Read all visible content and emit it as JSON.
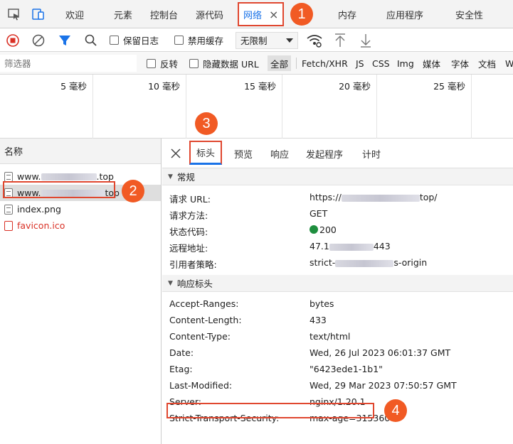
{
  "tabbar": {
    "tabs": [
      "欢迎",
      "元素",
      "控制台",
      "源代码",
      "网络",
      "内存",
      "应用程序",
      "安全性"
    ],
    "active_tab": "网络",
    "close_glyph": "×"
  },
  "toolbar": {
    "preserve_log": "保留日志",
    "disable_cache": "禁用缓存",
    "throttle": "无限制"
  },
  "filterbar": {
    "placeholder": "筛选器",
    "invert": "反转",
    "hide_data_urls": "隐藏数据 URL",
    "types": [
      "全部",
      "Fetch/XHR",
      "JS",
      "CSS",
      "Img",
      "媒体",
      "字体",
      "文档",
      "W"
    ],
    "selected_type": "全部"
  },
  "timeline": {
    "ticks": [
      "5 毫秒",
      "10 毫秒",
      "15 毫秒",
      "20 毫秒",
      "25 毫秒"
    ]
  },
  "requests": {
    "header": "名称",
    "items": [
      {
        "prefix": "www.",
        "suffix": ".top"
      },
      {
        "prefix": "www.",
        "suffix": "top"
      },
      {
        "name": "index.png"
      },
      {
        "name": "favicon.ico"
      }
    ]
  },
  "details": {
    "tabs": [
      "标头",
      "预览",
      "响应",
      "发起程序",
      "计时"
    ],
    "active_tab": "标头",
    "general": {
      "title": "常规",
      "rows": [
        {
          "k": "请求 URL:",
          "v_prefix": "https://",
          "v_suffix": "top/"
        },
        {
          "k": "请求方法:",
          "v": "GET"
        },
        {
          "k": "状态代码:",
          "v": "200"
        },
        {
          "k": "远程地址:",
          "v_prefix": "47.1",
          "v_suffix": "443"
        },
        {
          "k": "引用者策略:",
          "v_prefix": "strict-",
          "v_suffix": "s-origin"
        }
      ]
    },
    "response_headers": {
      "title": "响应标头",
      "rows": [
        {
          "k": "Accept-Ranges:",
          "v": "bytes"
        },
        {
          "k": "Content-Length:",
          "v": "433"
        },
        {
          "k": "Content-Type:",
          "v": "text/html"
        },
        {
          "k": "Date:",
          "v": "Wed, 26 Jul 2023 06:01:37 GMT"
        },
        {
          "k": "Etag:",
          "v": "\"6423ede1-1b1\""
        },
        {
          "k": "Last-Modified:",
          "v": "Wed, 29 Mar 2023 07:50:57 GMT"
        },
        {
          "k": "Server:",
          "v": "nginx/1.20.1"
        },
        {
          "k": "Strict-Transport-Security:",
          "v": "max-age=31536000"
        }
      ]
    }
  },
  "callouts": [
    "1",
    "2",
    "3",
    "4"
  ]
}
